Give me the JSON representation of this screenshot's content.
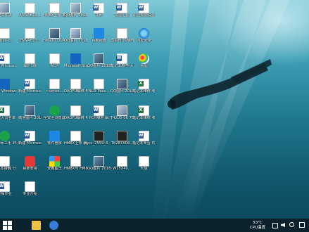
{
  "desktop": {
    "icons": [
      {
        "label": "建文件夹",
        "icon": "folder-icon",
        "kind": "photo2"
      },
      {
        "label": "A5WAB13...",
        "icon": "document-icon",
        "kind": "white"
      },
      {
        "label": "HM8X上传 截图",
        "icon": "document-icon",
        "kind": "white"
      },
      {
        "label": "QQ图片 2018040...",
        "icon": "image-file-icon",
        "kind": "photo2"
      },
      {
        "label": "冲利",
        "icon": "word-document-icon",
        "kind": "word"
      },
      {
        "label": "实验汇报",
        "icon": "word-document-icon",
        "kind": "word"
      },
      {
        "label": "职业规划设计",
        "icon": "word-document-icon",
        "kind": "word"
      },
      {
        "label": "series-c...",
        "icon": "document-icon",
        "kind": "white"
      },
      {
        "label": "Z5WAH13...",
        "icon": "document-icon",
        "kind": "white"
      },
      {
        "label": "HM170 QUANDA...",
        "icon": "image-file-icon",
        "kind": "photo"
      },
      {
        "label": "QQ图片 2018040...",
        "icon": "image-file-icon",
        "kind": "photo2"
      },
      {
        "label": "百度网盘",
        "icon": "baidu-netdisk-icon",
        "kind": "blue"
      },
      {
        "label": "虚拟BIOS使用",
        "icon": "document-icon",
        "kind": "white"
      },
      {
        "label": "网址大全",
        "icon": "internet-explorer-icon",
        "kind": "ie"
      },
      {
        "label": "新建 Microso...",
        "icon": "word-document-icon",
        "kind": "word"
      },
      {
        "label": "解析1课",
        "icon": "document-icon",
        "kind": "white"
      },
      {
        "label": "ACPI",
        "icon": "document-icon",
        "kind": "white"
      },
      {
        "label": "Microsoft Store",
        "icon": "microsoft-store-icon",
        "kind": "win"
      },
      {
        "label": "QQ图片 2018040...",
        "icon": "image-file-icon",
        "kind": "photo"
      },
      {
        "label": "笔记本教学 大纲",
        "icon": "word-document-icon",
        "kind": "word"
      },
      {
        "label": "画图",
        "icon": "paint-icon",
        "kind": "palette"
      },
      {
        "label": "微软 Windows...",
        "icon": "windows-icon",
        "kind": "win"
      },
      {
        "label": "新建 Microso...",
        "icon": "word-document-icon",
        "kind": "word"
      },
      {
        "label": "r-series...",
        "icon": "document-icon",
        "kind": "white"
      },
      {
        "label": "DAOFU解绑 电脑",
        "icon": "document-icon",
        "kind": "white"
      },
      {
        "label": "NLR_Pass...",
        "icon": "document-icon",
        "kind": "white"
      },
      {
        "label": "QQ图片 20180505...",
        "icon": "image-file-icon",
        "kind": "photo"
      },
      {
        "label": "笔记本维修 考核方案...",
        "icon": "excel-document-icon",
        "kind": "excel"
      },
      {
        "label": "黄安人员名单",
        "icon": "excel-document-icon",
        "kind": "excel"
      },
      {
        "label": "微信图片 2018050...",
        "icon": "image-file-icon",
        "kind": "photo"
      },
      {
        "label": "全安全浏览器",
        "icon": "browser-icon",
        "kind": "green"
      },
      {
        "label": "DAOFU解绑 电脑",
        "icon": "document-icon",
        "kind": "white"
      },
      {
        "label": "PCH接地 解",
        "icon": "word-document-icon",
        "kind": "word"
      },
      {
        "label": "T4205-0K 76",
        "icon": "image-file-icon",
        "kind": "photo2"
      },
      {
        "label": "笔记本维修 考核方案...",
        "icon": "excel-document-icon",
        "kind": "excel"
      },
      {
        "label": "鲁大师二手 iPhone",
        "icon": "utorrent-icon",
        "kind": "green"
      },
      {
        "label": "新建 Microso...",
        "icon": "word-document-icon",
        "kind": "word"
      },
      {
        "label": "软件管家",
        "icon": "tencent-software-icon",
        "kind": "blue"
      },
      {
        "label": "HM8X上传 编程",
        "icon": "document-icon",
        "kind": "white"
      },
      {
        "label": "pic_2559_8...",
        "icon": "image-file-icon",
        "kind": "dark"
      },
      {
        "label": "T8287X08...",
        "icon": "image-file-icon",
        "kind": "dark"
      },
      {
        "label": "笔记本专业 优势",
        "icon": "word-document-icon",
        "kind": "word"
      },
      {
        "label": "笔记本接触 分享",
        "icon": "document-icon",
        "kind": "white"
      },
      {
        "label": "易要安排",
        "icon": "red-app-icon",
        "kind": "red"
      },
      {
        "label": "安看图王",
        "icon": "image-viewer-icon",
        "kind": "tiles"
      },
      {
        "label": "HM8X与 HM8X上...",
        "icon": "document-icon",
        "kind": "white"
      },
      {
        "label": "QQ图片 2018040...",
        "icon": "image-file-icon",
        "kind": "photo"
      },
      {
        "label": "W25X40...",
        "icon": "document-icon",
        "kind": "white"
      },
      {
        "label": "大厨",
        "icon": "document-icon",
        "kind": "white"
      },
      {
        "label": "实操作业",
        "icon": "word-document-icon",
        "kind": "word"
      },
      {
        "label": "专业介绍",
        "icon": "document-icon",
        "kind": "white"
      }
    ]
  },
  "taskbar": {
    "start_icon": "windows-start-icon",
    "pinned": [
      "file-explorer-icon",
      "browser-icon"
    ],
    "temperature": "53°C",
    "cpu_label": "CPU温度"
  }
}
